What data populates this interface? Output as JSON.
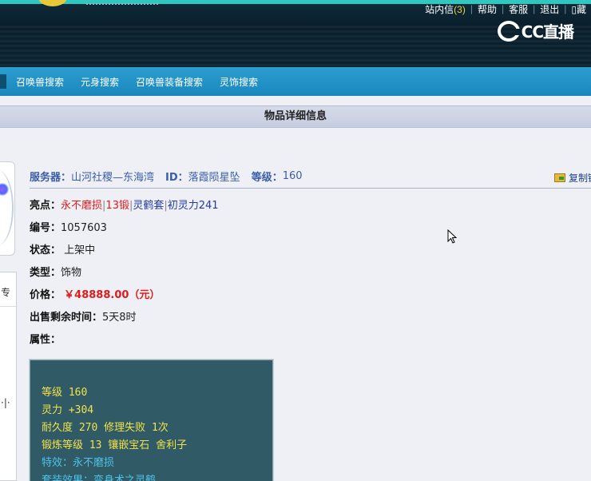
{
  "header": {
    "links": [
      {
        "label": "站内信",
        "count": "(3)"
      },
      {
        "label": "帮助"
      },
      {
        "label": "客服"
      },
      {
        "label": "退出"
      },
      {
        "label": "藏"
      }
    ],
    "watermark_text": "CC直播"
  },
  "nav": {
    "items": [
      "召唤兽搜索",
      "元身搜索",
      "召唤兽装备搜索",
      "灵饰搜索"
    ]
  },
  "section_title": "物品详细信息",
  "server_info": {
    "server_label": "服务器：",
    "server_value": "山河社稷—东海湾",
    "id_label": "ID：",
    "id_value": "落霞陨星坠",
    "level_label": "等级：",
    "level_value": "160",
    "copy_label": "复制链"
  },
  "item": {
    "highlights_label": "亮点：",
    "highlights": [
      "永不磨损",
      "13锻",
      "灵鹤套",
      "初灵力241"
    ],
    "number_label": "编号：",
    "number_value": "1057603",
    "status_label": "状态：",
    "status_value": "上架中",
    "type_label": "类型：",
    "type_value": "饰物",
    "price_label": "价格：",
    "price_value": "￥48888.00（元）",
    "remaining_label": "出售剩余时间：",
    "remaining_value": "5天8时",
    "attributes_label": "属性："
  },
  "attributes": [
    {
      "text": "等级 160",
      "color": "#f2e24a"
    },
    {
      "text": "灵力 +304",
      "color": "#f2e24a"
    },
    {
      "text": "耐久度 270 修理失败 1次",
      "color": "#f2e24a"
    },
    {
      "text": "锻炼等级 13 镶嵌宝石 舍利子",
      "color": "#f2e24a"
    },
    {
      "text": "特效：永不磨损",
      "color": "#4fc3e8"
    },
    {
      "text": "套装效果：变身术之灵鹤",
      "color": "#4fc3e8"
    }
  ],
  "left_panel": {
    "glyph_top": "专",
    "glyph_mid": "·|·"
  }
}
